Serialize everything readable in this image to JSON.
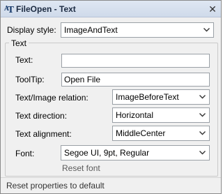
{
  "window": {
    "title": "FileOpen - Text",
    "close_glyph": "✕"
  },
  "display_style": {
    "label": "Display style:",
    "value": "ImageAndText"
  },
  "group": {
    "title": "Text",
    "text": {
      "label": "Text:",
      "value": ""
    },
    "tooltip": {
      "label": "ToolTip:",
      "value": "Open File"
    },
    "text_image_relation": {
      "label": "Text/Image relation:",
      "value": "ImageBeforeText"
    },
    "text_direction": {
      "label": "Text direction:",
      "value": "Horizontal"
    },
    "text_alignment": {
      "label": "Text alignment:",
      "value": "MiddleCenter"
    },
    "font": {
      "label": "Font:",
      "value": "Segoe UI, 9pt, Regular",
      "reset_label": "Reset font"
    }
  },
  "footer": {
    "reset_label": "Reset properties to default"
  }
}
